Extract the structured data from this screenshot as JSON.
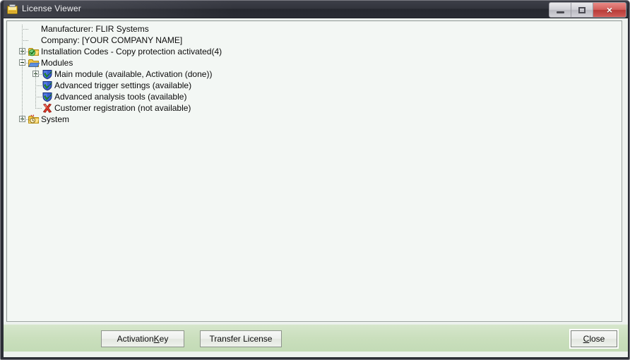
{
  "window": {
    "title": "License Viewer",
    "icon": "license-window-icon",
    "controls": {
      "minimize": {
        "name": "minimize-button",
        "glyph": "minimize-icon"
      },
      "maximize": {
        "name": "maximize-button",
        "glyph": "maximize-icon"
      },
      "close": {
        "name": "close-window-button",
        "glyph": "close-icon",
        "symbol": "×",
        "color": "#b83b38"
      }
    }
  },
  "tree": {
    "nodes": [
      {
        "id": "manufacturer",
        "label": "Manufacturer: FLIR Systems",
        "depth": 0,
        "expander": "none",
        "icon": "none"
      },
      {
        "id": "company",
        "label": "Company: [YOUR COMPANY NAME]",
        "depth": 0,
        "expander": "none",
        "icon": "none"
      },
      {
        "id": "installation-codes",
        "label": "Installation Codes - Copy protection activated(4)",
        "depth": 0,
        "expander": "plus",
        "icon": "folder-check-icon"
      },
      {
        "id": "modules",
        "label": "Modules",
        "depth": 0,
        "expander": "minus",
        "icon": "folder-open-icon"
      },
      {
        "id": "main-module",
        "label": "Main module (available, Activation (done))",
        "depth": 1,
        "expander": "plus",
        "icon": "shield-check-icon"
      },
      {
        "id": "advanced-trigger-settings",
        "label": "Advanced trigger settings (available)",
        "depth": 1,
        "expander": "none",
        "icon": "shield-check-icon"
      },
      {
        "id": "advanced-analysis-tools",
        "label": "Advanced analysis tools (available)",
        "depth": 1,
        "expander": "none",
        "icon": "shield-check-icon"
      },
      {
        "id": "customer-registration",
        "label": "Customer registration (not available)",
        "depth": 1,
        "expander": "none",
        "icon": "red-x-icon"
      },
      {
        "id": "system",
        "label": "System",
        "depth": 0,
        "expander": "plus",
        "icon": "folder-clock-icon"
      }
    ]
  },
  "footer": {
    "activation_key": {
      "pre": "Activation ",
      "mnemonic": "K",
      "post": "ey"
    },
    "transfer_license": {
      "label": "Transfer License"
    },
    "close": {
      "mnemonic": "C",
      "post": "lose"
    }
  },
  "colors": {
    "titlebar": "#2c2e36",
    "footer": "#cadfbd",
    "tree_background": "#f3f7f4",
    "client_background": "#eef2ef",
    "close_button": "#b83b38",
    "shield": "#3a5fd0",
    "check": "#2faa2f",
    "folder": "#f2c646"
  }
}
